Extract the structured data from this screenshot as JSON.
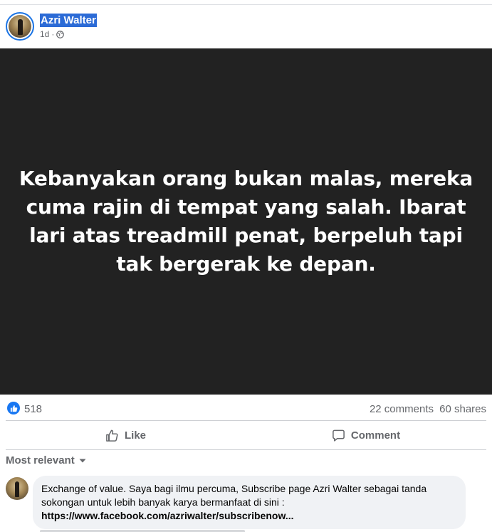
{
  "post": {
    "author": "Azri Walter",
    "time": "1d",
    "separator": "·",
    "privacy_icon": "globe-icon",
    "quote": "Kebanyakan orang bukan malas, mereka cuma rajin di tempat yang salah. Ibarat lari atas treadmill penat, berpeluh tapi tak bergerak ke depan."
  },
  "stats": {
    "reaction_icon": "like-badge-icon",
    "likes": "518",
    "comments": "22 comments",
    "shares": "60 shares"
  },
  "actions": {
    "like_label": "Like",
    "comment_label": "Comment"
  },
  "comments_section": {
    "sort_label": "Most relevant",
    "comments": [
      {
        "text": "Exchange of value. Saya bagi ilmu percuma, Subscribe page Azri Walter sebagai tanda sokongan untuk lebih banyak karya bermanfaat di sini :",
        "link": "https://www.facebook.com/azriwalter/subscribenow..."
      }
    ]
  },
  "colors": {
    "accent": "#1877f2",
    "image_background": "#222222",
    "muted_text": "#65676b",
    "comment_bubble": "#f0f2f5"
  }
}
